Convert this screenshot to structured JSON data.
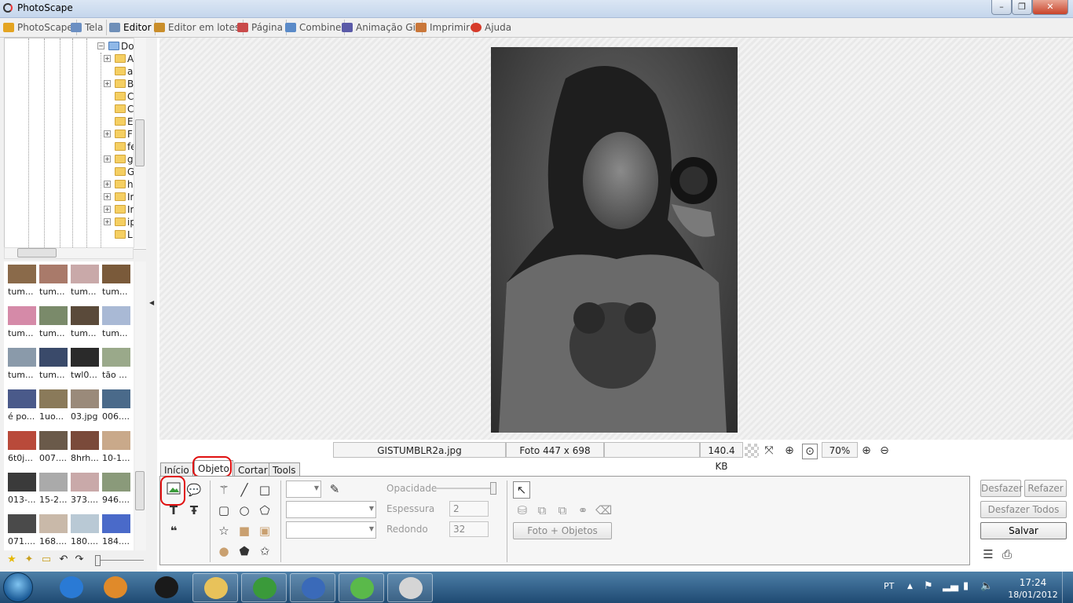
{
  "window": {
    "title": "PhotoScape",
    "close_glyph": "✕",
    "max_glyph": "❐",
    "min_glyph": "–"
  },
  "menu": [
    {
      "label": "PhotoScape",
      "icon": "photoscape-icon",
      "color": "#e4a421"
    },
    {
      "label": "Tela",
      "icon": "viewer-icon",
      "color": "#6b8fc2"
    },
    {
      "label": "Editor",
      "icon": "editor-icon",
      "color": "#6f8fb8"
    },
    {
      "label": "Editor em lotes",
      "icon": "batch-editor-icon",
      "color": "#c98e2b"
    },
    {
      "label": "Página",
      "icon": "page-icon",
      "color": "#c94a4a"
    },
    {
      "label": "Combine",
      "icon": "combine-icon",
      "color": "#5a8ac8"
    },
    {
      "label": "Animação Gif",
      "icon": "gif-icon",
      "color": "#5a5aa8"
    },
    {
      "label": "Imprimir",
      "icon": "print-icon",
      "color": "#c9773a"
    },
    {
      "label": "Ajuda",
      "icon": "help-icon",
      "color": "#d63a2a"
    }
  ],
  "active_menu": "Editor",
  "tree": {
    "root": "Dow",
    "items": [
      "A",
      "a",
      "B",
      "C",
      "C",
      "E",
      "F",
      "fe",
      "g",
      "G",
      "h",
      "Ir",
      "Ir",
      "ip",
      "L"
    ]
  },
  "thumbnails": [
    {
      "caption": "tum...",
      "color": "#8a6a4a"
    },
    {
      "caption": "tum...",
      "color": "#a97a6a"
    },
    {
      "caption": "tum...",
      "color": "#c9a9a9"
    },
    {
      "caption": "tum...",
      "color": "#7a5a3a"
    },
    {
      "caption": "tum...",
      "color": "#d58aa8"
    },
    {
      "caption": "tum...",
      "color": "#7a8a6a"
    },
    {
      "caption": "tum...",
      "color": "#5a4a3a"
    },
    {
      "caption": "tum...",
      "color": "#a9b9d5"
    },
    {
      "caption": "tum...",
      "color": "#8a9aaa"
    },
    {
      "caption": "tum...",
      "color": "#3a4a6a"
    },
    {
      "caption": "twl0...",
      "color": "#2a2a2a"
    },
    {
      "caption": "tão ...",
      "color": "#9aa98a"
    },
    {
      "caption": "é po...",
      "color": "#4a5a8a"
    },
    {
      "caption": "1uo...",
      "color": "#8a7a5a"
    },
    {
      "caption": "03.jpg",
      "color": "#9a8a7a"
    },
    {
      "caption": "006....",
      "color": "#4a6a8a"
    },
    {
      "caption": "6t0j...",
      "color": "#b94a3a"
    },
    {
      "caption": "007....",
      "color": "#6a5a4a"
    },
    {
      "caption": "8hrh...",
      "color": "#7a4a3a"
    },
    {
      "caption": "10-1...",
      "color": "#c9a98a"
    },
    {
      "caption": "013-...",
      "color": "#3a3a3a"
    },
    {
      "caption": "15-2...",
      "color": "#aaaaaa"
    },
    {
      "caption": "373....",
      "color": "#c9a9a9"
    },
    {
      "caption": "946....",
      "color": "#8a9a7a"
    },
    {
      "caption": "071....",
      "color": "#4a4a4a"
    },
    {
      "caption": "168....",
      "color": "#c9b9a9"
    },
    {
      "caption": "180....",
      "color": "#b9c9d5"
    },
    {
      "caption": "184....",
      "color": "#4a6ac9"
    }
  ],
  "status": {
    "filename": "GISTUMBLR2a.jpg",
    "dimensions": "Foto 447 x 698",
    "filesize": "140.4 KB",
    "zoom": "70%"
  },
  "editor_tabs": [
    "Início",
    "Objeto",
    "Cortar",
    "Tools"
  ],
  "active_editor_tab": "Objeto",
  "object_panel": {
    "opacity_label": "Opacidade",
    "thickness_label": "Espessura",
    "thickness_value": "2",
    "round_label": "Redondo",
    "round_value": "32",
    "photo_objects_button": "Foto + Objetos"
  },
  "right_buttons": {
    "undo": "Desfazer",
    "redo": "Refazer",
    "undo_all": "Desfazer Todos",
    "save": "Salvar"
  },
  "taskbar": {
    "apps": [
      {
        "name": "internet-explorer",
        "color": "#2a7ad5"
      },
      {
        "name": "media-player",
        "color": "#e08a2a"
      },
      {
        "name": "hp",
        "color": "#1a1a1a"
      },
      {
        "name": "explorer",
        "color": "#e8c25a"
      },
      {
        "name": "chrome",
        "color": "#3a9a3a"
      },
      {
        "name": "office-manager",
        "color": "#3a6ab9"
      },
      {
        "name": "messenger",
        "color": "#5ab94a"
      },
      {
        "name": "photoscape",
        "color": "#d5d5d5"
      }
    ],
    "language": "PT",
    "time": "17:24",
    "date": "18/01/2012"
  }
}
